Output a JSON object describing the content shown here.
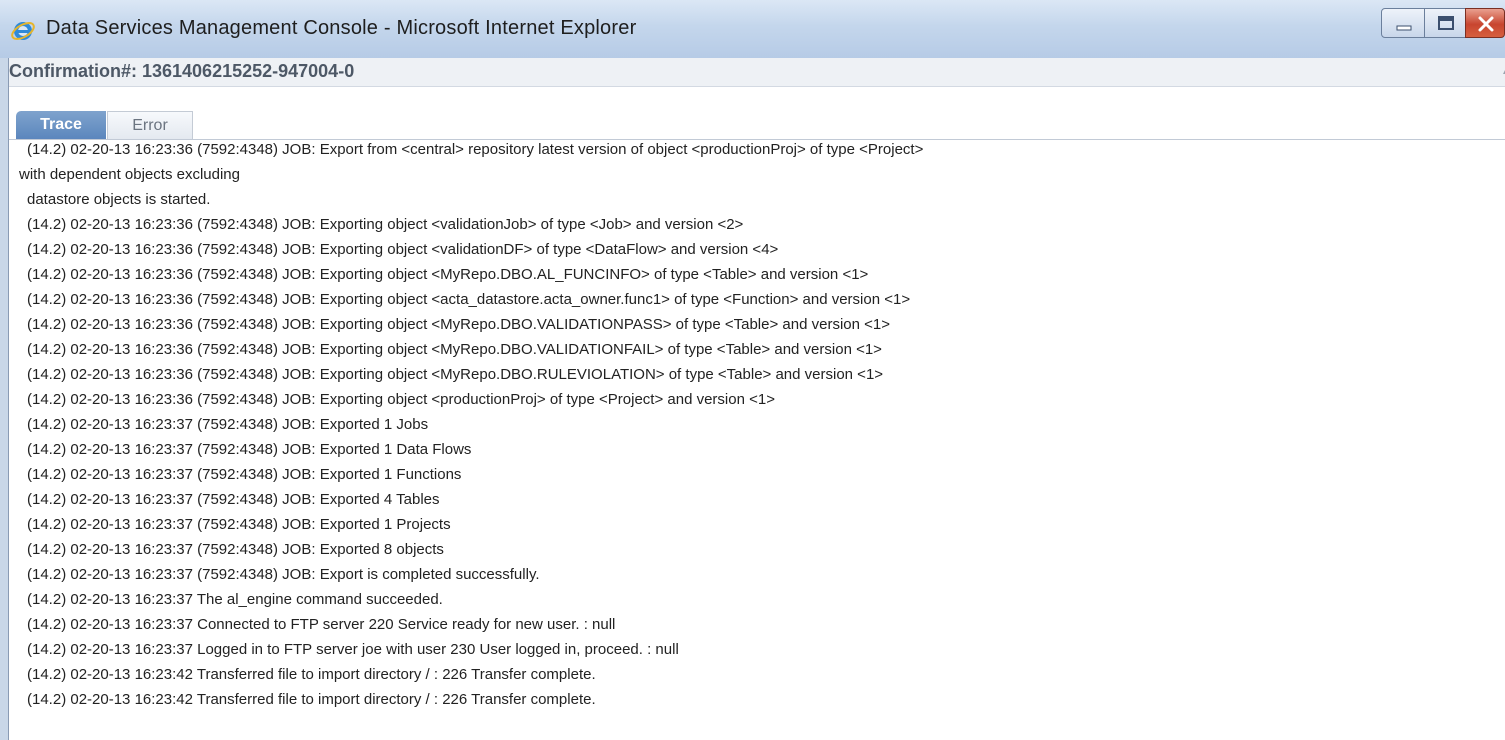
{
  "window": {
    "title": "Data Services Management Console - Microsoft Internet Explorer",
    "controls": {
      "minimize": "minimize",
      "maximize": "maximize",
      "close": "close"
    }
  },
  "confirmation": "Confirmation#: 1361406215252-947004-0",
  "tabs": [
    {
      "label": "Trace",
      "active": true
    },
    {
      "label": "Error",
      "active": false
    }
  ],
  "log_lines": [
    " (14.2) 02-20-13 16:23:36 (7592:4348) JOB: Export from <central> repository latest version of object <productionProj> of type <Project>",
    "with dependent objects excluding",
    " datastore objects is started.",
    " (14.2) 02-20-13 16:23:36 (7592:4348) JOB: Exporting object <validationJob> of type <Job> and version <2>",
    " (14.2) 02-20-13 16:23:36 (7592:4348) JOB: Exporting object <validationDF> of type <DataFlow> and version <4>",
    " (14.2) 02-20-13 16:23:36 (7592:4348) JOB: Exporting object <MyRepo.DBO.AL_FUNCINFO> of type <Table> and version <1>",
    " (14.2) 02-20-13 16:23:36 (7592:4348) JOB: Exporting object <acta_datastore.acta_owner.func1> of type <Function> and version <1>",
    " (14.2) 02-20-13 16:23:36 (7592:4348) JOB: Exporting object <MyRepo.DBO.VALIDATIONPASS> of type <Table> and version <1>",
    " (14.2) 02-20-13 16:23:36 (7592:4348) JOB: Exporting object <MyRepo.DBO.VALIDATIONFAIL> of type <Table> and version <1>",
    " (14.2) 02-20-13 16:23:36 (7592:4348) JOB: Exporting object <MyRepo.DBO.RULEVIOLATION> of type <Table> and version <1>",
    " (14.2) 02-20-13 16:23:36 (7592:4348) JOB: Exporting object <productionProj> of type <Project> and version <1>",
    " (14.2) 02-20-13 16:23:37 (7592:4348) JOB: Exported 1 Jobs",
    " (14.2) 02-20-13 16:23:37 (7592:4348) JOB: Exported 1 Data Flows",
    " (14.2) 02-20-13 16:23:37 (7592:4348) JOB: Exported 1 Functions",
    " (14.2) 02-20-13 16:23:37 (7592:4348) JOB: Exported 4 Tables",
    " (14.2) 02-20-13 16:23:37 (7592:4348) JOB: Exported 1 Projects",
    " (14.2) 02-20-13 16:23:37 (7592:4348) JOB: Exported 8 objects",
    " (14.2) 02-20-13 16:23:37 (7592:4348) JOB: Export is completed successfully.",
    " (14.2) 02-20-13 16:23:37 The al_engine command succeeded.",
    " (14.2) 02-20-13 16:23:37 Connected to FTP server 220 Service ready for new user. : null",
    " (14.2) 02-20-13 16:23:37 Logged in to FTP server joe with user 230 User logged in, proceed. : null",
    " (14.2) 02-20-13 16:23:42 Transferred file to import directory / : 226 Transfer complete.",
    " (14.2) 02-20-13 16:23:42 Transferred file to import directory / : 226 Transfer complete."
  ]
}
